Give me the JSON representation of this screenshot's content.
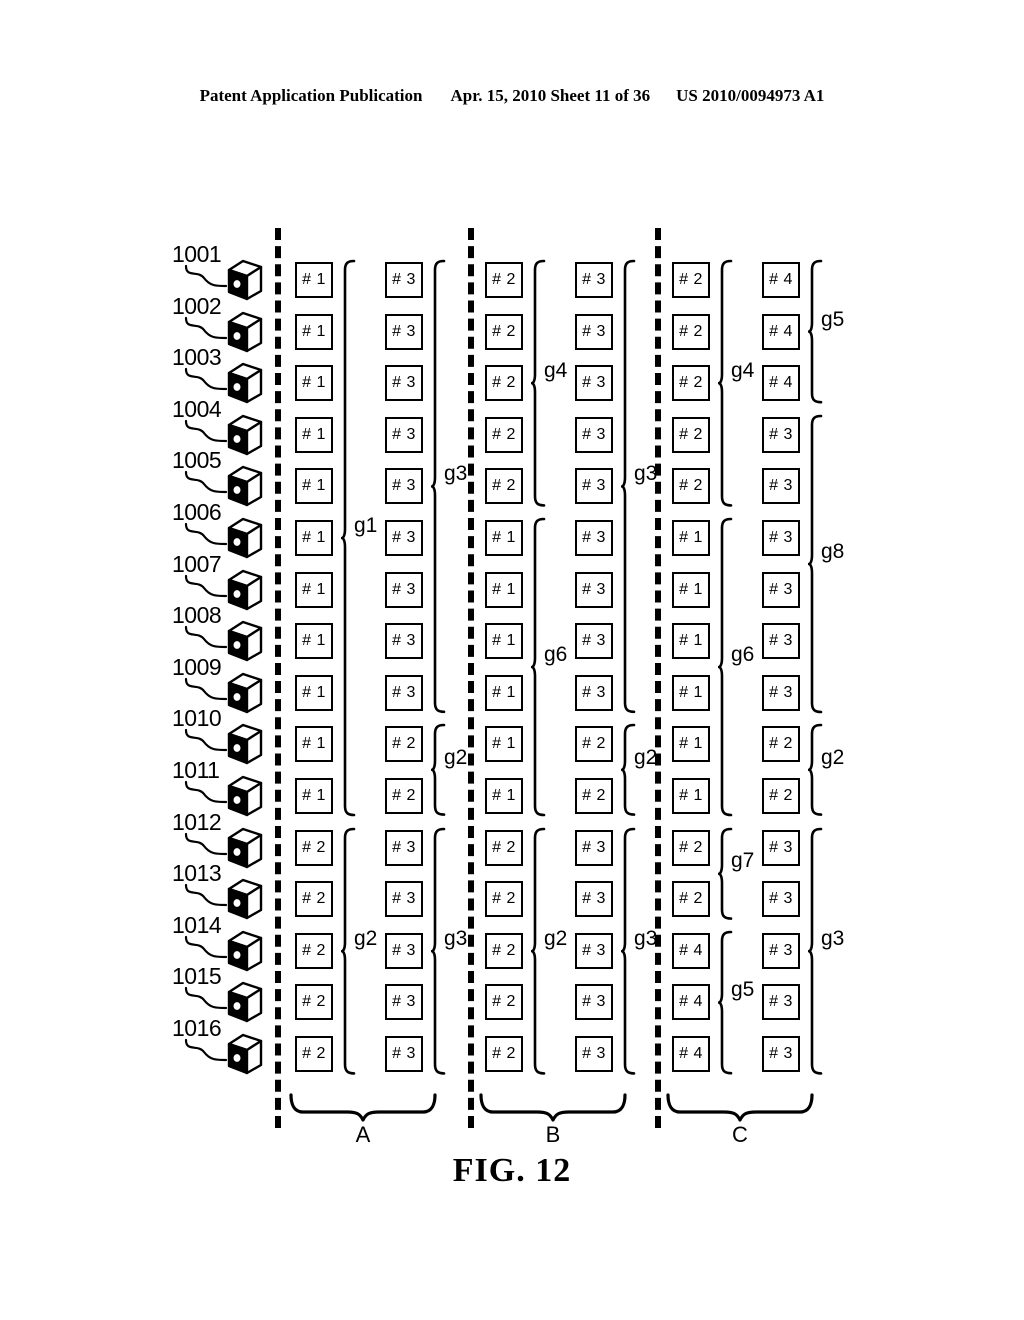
{
  "header": {
    "left": "Patent Application Publication",
    "middle": "Apr. 15, 2010  Sheet 11 of 36",
    "right": "US 2010/0094973 A1"
  },
  "figure": {
    "caption": "FIG. 12",
    "row_labels": [
      "1001",
      "1002",
      "1003",
      "1004",
      "1005",
      "1006",
      "1007",
      "1008",
      "1009",
      "1010",
      "1011",
      "1012",
      "1013",
      "1014",
      "1015",
      "1016"
    ],
    "server_icon": "server-icon",
    "sections": [
      {
        "id": "A",
        "label": "A"
      },
      {
        "id": "B",
        "label": "B"
      },
      {
        "id": "C",
        "label": "C"
      }
    ],
    "columns": [
      {
        "id": "A1",
        "section": "A",
        "cells": [
          "# 1",
          "# 1",
          "# 1",
          "# 1",
          "# 1",
          "# 1",
          "# 1",
          "# 1",
          "# 1",
          "# 1",
          "# 1",
          "# 2",
          "# 2",
          "# 2",
          "# 2",
          "# 2"
        ],
        "groups": [
          {
            "label": "g1",
            "start": 1,
            "end": 11
          },
          {
            "label": "g2",
            "start": 12,
            "end": 16
          }
        ]
      },
      {
        "id": "A2",
        "section": "A",
        "cells": [
          "# 3",
          "# 3",
          "# 3",
          "# 3",
          "# 3",
          "# 3",
          "# 3",
          "# 3",
          "# 3",
          "# 2",
          "# 2",
          "# 3",
          "# 3",
          "# 3",
          "# 3",
          "# 3"
        ],
        "groups": [
          {
            "label": "g3",
            "start": 1,
            "end": 9
          },
          {
            "label": "g2",
            "start": 10,
            "end": 11
          },
          {
            "label": "g3",
            "start": 12,
            "end": 16
          }
        ]
      },
      {
        "id": "B1",
        "section": "B",
        "cells": [
          "# 2",
          "# 2",
          "# 2",
          "# 2",
          "# 2",
          "# 1",
          "# 1",
          "# 1",
          "# 1",
          "# 1",
          "# 1",
          "# 2",
          "# 2",
          "# 2",
          "# 2",
          "# 2"
        ],
        "groups": [
          {
            "label": "g4",
            "start": 1,
            "end": 5
          },
          {
            "label": "g6",
            "start": 6,
            "end": 11
          },
          {
            "label": "g2",
            "start": 12,
            "end": 16
          }
        ]
      },
      {
        "id": "B2",
        "section": "B",
        "cells": [
          "# 3",
          "# 3",
          "# 3",
          "# 3",
          "# 3",
          "# 3",
          "# 3",
          "# 3",
          "# 3",
          "# 2",
          "# 2",
          "# 3",
          "# 3",
          "# 3",
          "# 3",
          "# 3"
        ],
        "groups": [
          {
            "label": "g3",
            "start": 1,
            "end": 9
          },
          {
            "label": "g2",
            "start": 10,
            "end": 11
          },
          {
            "label": "g3",
            "start": 12,
            "end": 16
          }
        ]
      },
      {
        "id": "C1",
        "section": "C",
        "cells": [
          "# 2",
          "# 2",
          "# 2",
          "# 2",
          "# 2",
          "# 1",
          "# 1",
          "# 1",
          "# 1",
          "# 1",
          "# 1",
          "# 2",
          "# 2",
          "# 4",
          "# 4",
          "# 4"
        ],
        "groups": [
          {
            "label": "g4",
            "start": 1,
            "end": 5
          },
          {
            "label": "g6",
            "start": 6,
            "end": 11
          },
          {
            "label": "g7",
            "start": 12,
            "end": 13
          },
          {
            "label": "g5",
            "start": 14,
            "end": 16
          }
        ]
      },
      {
        "id": "C2",
        "section": "C",
        "cells": [
          "# 4",
          "# 4",
          "# 4",
          "# 3",
          "# 3",
          "# 3",
          "# 3",
          "# 3",
          "# 3",
          "# 2",
          "# 2",
          "# 3",
          "# 3",
          "# 3",
          "# 3",
          "# 3"
        ],
        "groups": [
          {
            "label": "g5",
            "start": 1,
            "end": 3
          },
          {
            "label": "g8",
            "start": 4,
            "end": 9
          },
          {
            "label": "g2",
            "start": 10,
            "end": 11
          },
          {
            "label": "g3",
            "start": 12,
            "end": 16
          }
        ]
      }
    ]
  }
}
